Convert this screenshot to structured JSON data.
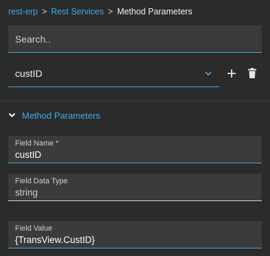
{
  "breadcrumb": {
    "items": [
      "rest-erp",
      "Rest Services"
    ],
    "separator": ">",
    "current": "Method Parameters"
  },
  "search": {
    "placeholder": "Search..",
    "value": ""
  },
  "selector": {
    "selected": "custID",
    "icon": "chevron-down-icon"
  },
  "actions": {
    "add_icon": "plus-icon",
    "delete_icon": "trash-icon"
  },
  "section": {
    "title": "Method Parameters",
    "expanded": true,
    "icon": "chevron-down-icon"
  },
  "fields": {
    "name": {
      "label": "Field Name *",
      "value": "custID"
    },
    "data_type": {
      "label": "Field Data Type",
      "value": "string"
    },
    "field_value": {
      "label": "Field Value",
      "value": "{TransView.CustID}"
    }
  },
  "colors": {
    "background": "#2b2b2b",
    "field_background": "#3b3b3b",
    "accent": "#3fa9e8",
    "text": "#e6e6e6"
  }
}
